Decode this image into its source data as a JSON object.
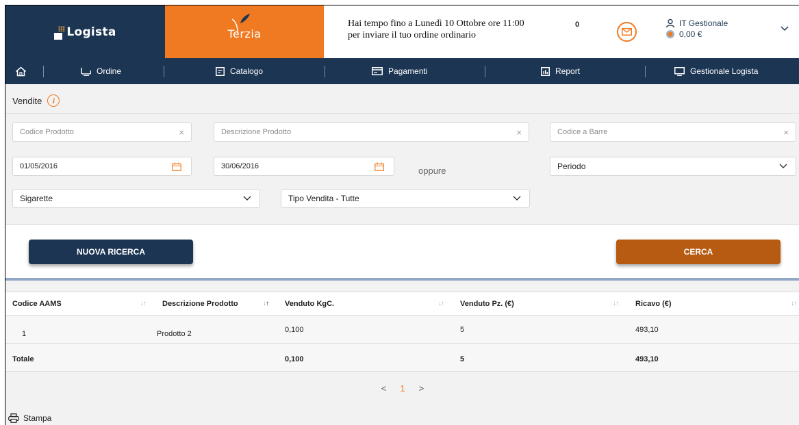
{
  "header": {
    "logo_logista": "Logista",
    "logo_terzia": "Terzia",
    "notice_line1": "Hai tempo fino a Lunedì 10 Ottobre ore 11:00",
    "notice_line2": "per inviare il tuo ordine ordinario",
    "marker": "0",
    "user_name": "IT Gestionale",
    "balance": "0,00 €"
  },
  "nav": {
    "items": [
      {
        "label": "Ordine",
        "icon": "cart-icon"
      },
      {
        "label": "Catalogo",
        "icon": "catalog-icon"
      },
      {
        "label": "Pagamenti",
        "icon": "card-icon"
      },
      {
        "label": "Report",
        "icon": "report-icon"
      },
      {
        "label": "Gestionale Logista",
        "icon": "monitor-icon"
      }
    ]
  },
  "page": {
    "title": "Vendite",
    "info_icon": "i"
  },
  "form": {
    "codice_prodotto_ph": "Codice Prodotto",
    "descrizione_prodotto_ph": "Descrizione Prodotto",
    "codice_barre_ph": "Codice a Barre",
    "date_from": "01/05/2016",
    "date_to": "30/06/2016",
    "oppure": "oppure",
    "periodo": "Periodo",
    "categoria": "Sigarette",
    "tipo_vendita": "Tipo Vendita - Tutte",
    "clear_symbol": "×"
  },
  "buttons": {
    "nuova_ricerca": "NUOVA RICERCA",
    "cerca": "CERCA"
  },
  "table": {
    "headers": [
      "Codice AAMS",
      "Descrizione Prodotto",
      "Venduto KgC.",
      "Venduto Pz. (€)",
      "Ricavo (€)"
    ],
    "rows": [
      {
        "codice": "1",
        "descrizione": "Prodotto 2",
        "kg": "0,100",
        "pz": "5",
        "ricavo": "493,10"
      }
    ],
    "total": {
      "label": "Totale",
      "kg": "0,100",
      "pz": "5",
      "ricavo": "493,10"
    }
  },
  "pager": {
    "prev": "<",
    "current": "1",
    "next": ">"
  },
  "footer": {
    "print_label": "Stampa"
  },
  "colors": {
    "navy": "#1c3553",
    "orange": "#f07a22",
    "search_button": "#b75a12"
  }
}
